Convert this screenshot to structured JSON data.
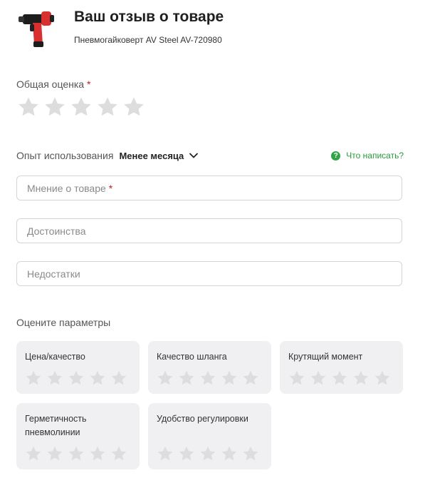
{
  "header": {
    "title": "Ваш отзыв о товаре",
    "product_name": "Пневмогайковерт AV Steel AV-720980"
  },
  "overall": {
    "label": "Общая оценка",
    "required_mark": "*",
    "rating": 0,
    "max": 5
  },
  "experience": {
    "label": "Опыт использования",
    "value": "Менее месяца"
  },
  "help": {
    "icon_glyph": "?",
    "label": "Что написать?"
  },
  "fields": {
    "opinion": {
      "placeholder": "Мнение о товаре",
      "required_mark": "*",
      "value": ""
    },
    "pros": {
      "placeholder": "Достоинства",
      "value": ""
    },
    "cons": {
      "placeholder": "Недостатки",
      "value": ""
    }
  },
  "params": {
    "label": "Оцените параметры",
    "items": [
      {
        "name": "Цена/качество",
        "rating": 0
      },
      {
        "name": "Качество шланга",
        "rating": 0
      },
      {
        "name": "Крутящий момент",
        "rating": 0
      },
      {
        "name": "Герметичность пневмолинии",
        "rating": 0
      },
      {
        "name": "Удобство регулировки",
        "rating": 0
      }
    ]
  },
  "colors": {
    "star_empty": "#dddddd",
    "card_bg": "#f0f0f2",
    "accent_green": "#2fa548",
    "required_red": "#c41f1f"
  }
}
